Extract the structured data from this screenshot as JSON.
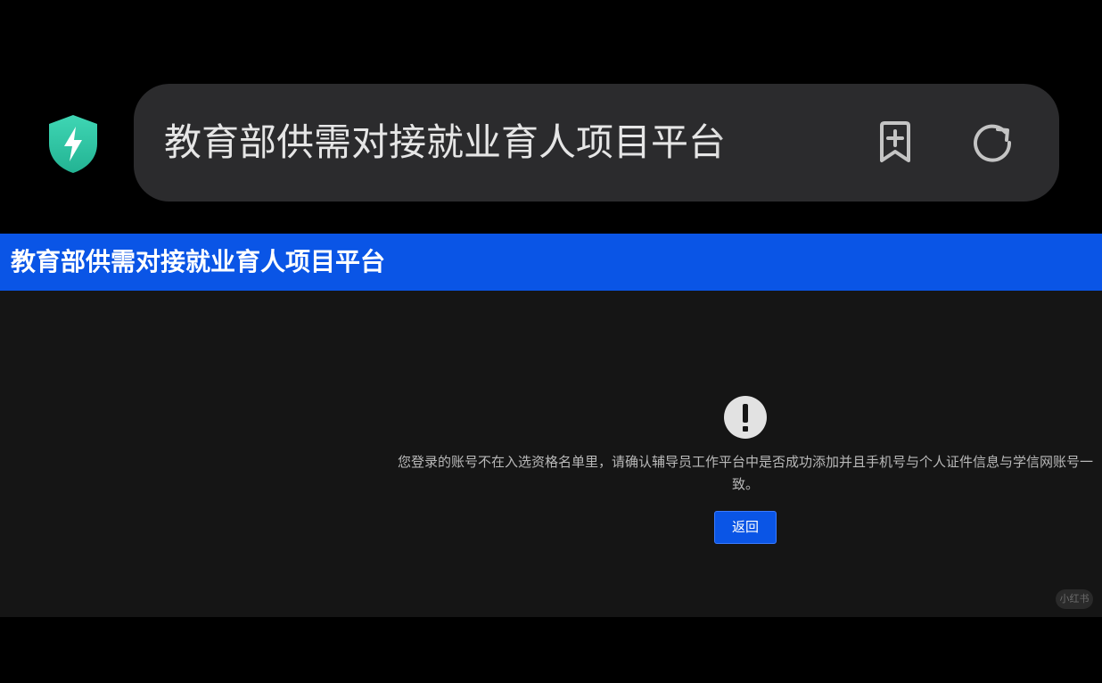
{
  "browser": {
    "address_text": "教育部供需对接就业育人项目平台",
    "icons": {
      "security": "shield-lightning-icon",
      "bookmark": "bookmark-add-icon",
      "reload": "reload-icon"
    },
    "colors": {
      "shield": "#34c6a7",
      "address_bar_bg": "#2b2b2d"
    }
  },
  "page": {
    "header_title": "教育部供需对接就业育人项目平台",
    "alert_icon": "exclamation-circle-icon",
    "message": "您登录的账号不在入选资格名单里，请确认辅导员工作平台中是否成功添加并且手机号与个人证件信息与学信网账号一致。",
    "back_button_label": "返回",
    "watermark": "小红书",
    "colors": {
      "header_bg": "#0a55e6",
      "content_bg": "#151515",
      "button_bg": "#0a55e6"
    }
  }
}
